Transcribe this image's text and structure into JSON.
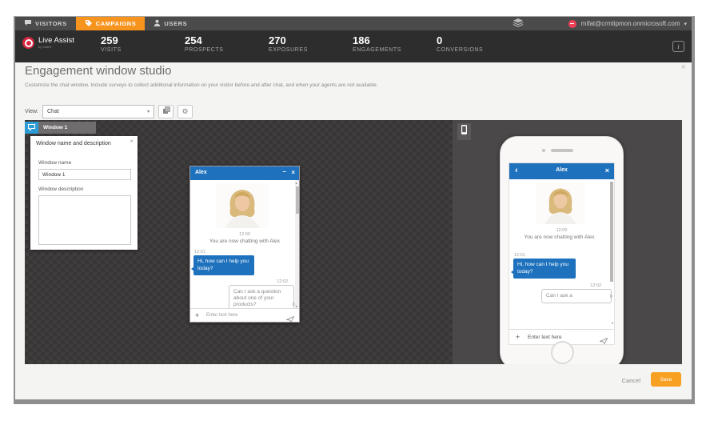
{
  "topnav": {
    "tabs": [
      {
        "label": "VISITORS"
      },
      {
        "label": "CAMPAIGNS"
      },
      {
        "label": "USERS"
      }
    ],
    "account_email": "mifat@crmtipmon.onmicrosoft.com"
  },
  "statsbar": {
    "brand": {
      "name": "Live Assist",
      "tagline": "by CaféX"
    },
    "stats": [
      {
        "value": "259",
        "label": "VISITS"
      },
      {
        "value": "254",
        "label": "PROSPECTS"
      },
      {
        "value": "270",
        "label": "EXPOSURES"
      },
      {
        "value": "186",
        "label": "ENGAGEMENTS"
      },
      {
        "value": "0",
        "label": "CONVERSIONS"
      }
    ]
  },
  "studio": {
    "title": "Engagement window studio",
    "description": "Customize the chat window. Include surveys to collect additional information on your visitor before and after chat, and when your agents are not available.",
    "view_label": "View:",
    "view_value": "Chat"
  },
  "canvas": {
    "window_tab": "Window 1",
    "panel": {
      "title": "Window name and description",
      "name_label": "Window name",
      "name_value": "Window 1",
      "description_label": "Window description",
      "description_value": ""
    },
    "chat": {
      "agent_name": "Alex",
      "ts1": "12:00",
      "system_message": "You are now chatting with Alex",
      "ts2": "12:01",
      "agent_message": "Hi, how can I help you today?",
      "ts3": "12:02",
      "visitor_message": "Can I ask a question about one of your products?",
      "visitor_message_short": "Can I ask a",
      "input_placeholder": "Enter text here"
    }
  },
  "footer": {
    "cancel_label": "Cancel",
    "save_label": "Save"
  },
  "icons": {
    "close_glyph": "×",
    "minimize_glyph": "–",
    "chevron_down_glyph": "▾",
    "back_glyph": "‹",
    "plus_glyph": "+",
    "scroll_up_glyph": "▴",
    "scroll_down_glyph": "▾",
    "info_glyph": "i",
    "gear_glyph": "⚙"
  },
  "colors": {
    "accent_orange": "#f7941e",
    "save_orange": "#f7a022",
    "chat_blue": "#1d71bd",
    "presence_red": "#ef4056",
    "canvas_dark": "#383636"
  }
}
